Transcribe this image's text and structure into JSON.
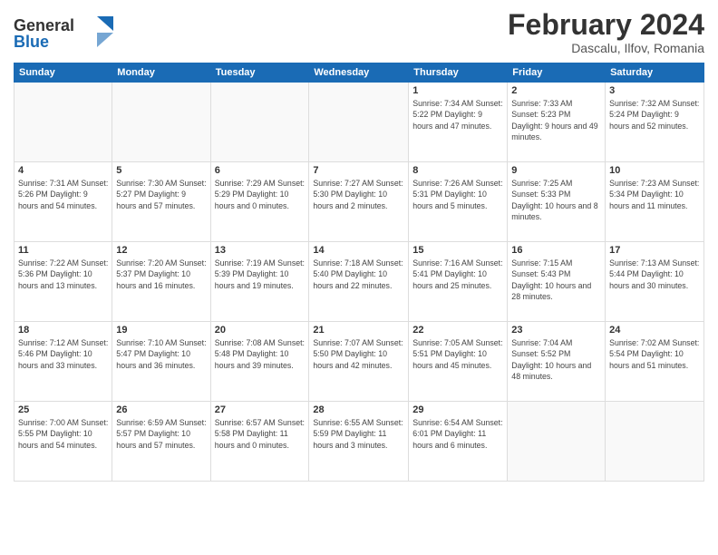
{
  "logo": {
    "line1": "General",
    "line2": "Blue"
  },
  "title": "February 2024",
  "location": "Dascalu, Ilfov, Romania",
  "days_of_week": [
    "Sunday",
    "Monday",
    "Tuesday",
    "Wednesday",
    "Thursday",
    "Friday",
    "Saturday"
  ],
  "weeks": [
    [
      {
        "day": "",
        "info": ""
      },
      {
        "day": "",
        "info": ""
      },
      {
        "day": "",
        "info": ""
      },
      {
        "day": "",
        "info": ""
      },
      {
        "day": "1",
        "info": "Sunrise: 7:34 AM\nSunset: 5:22 PM\nDaylight: 9 hours\nand 47 minutes."
      },
      {
        "day": "2",
        "info": "Sunrise: 7:33 AM\nSunset: 5:23 PM\nDaylight: 9 hours\nand 49 minutes."
      },
      {
        "day": "3",
        "info": "Sunrise: 7:32 AM\nSunset: 5:24 PM\nDaylight: 9 hours\nand 52 minutes."
      }
    ],
    [
      {
        "day": "4",
        "info": "Sunrise: 7:31 AM\nSunset: 5:26 PM\nDaylight: 9 hours\nand 54 minutes."
      },
      {
        "day": "5",
        "info": "Sunrise: 7:30 AM\nSunset: 5:27 PM\nDaylight: 9 hours\nand 57 minutes."
      },
      {
        "day": "6",
        "info": "Sunrise: 7:29 AM\nSunset: 5:29 PM\nDaylight: 10 hours\nand 0 minutes."
      },
      {
        "day": "7",
        "info": "Sunrise: 7:27 AM\nSunset: 5:30 PM\nDaylight: 10 hours\nand 2 minutes."
      },
      {
        "day": "8",
        "info": "Sunrise: 7:26 AM\nSunset: 5:31 PM\nDaylight: 10 hours\nand 5 minutes."
      },
      {
        "day": "9",
        "info": "Sunrise: 7:25 AM\nSunset: 5:33 PM\nDaylight: 10 hours\nand 8 minutes."
      },
      {
        "day": "10",
        "info": "Sunrise: 7:23 AM\nSunset: 5:34 PM\nDaylight: 10 hours\nand 11 minutes."
      }
    ],
    [
      {
        "day": "11",
        "info": "Sunrise: 7:22 AM\nSunset: 5:36 PM\nDaylight: 10 hours\nand 13 minutes."
      },
      {
        "day": "12",
        "info": "Sunrise: 7:20 AM\nSunset: 5:37 PM\nDaylight: 10 hours\nand 16 minutes."
      },
      {
        "day": "13",
        "info": "Sunrise: 7:19 AM\nSunset: 5:39 PM\nDaylight: 10 hours\nand 19 minutes."
      },
      {
        "day": "14",
        "info": "Sunrise: 7:18 AM\nSunset: 5:40 PM\nDaylight: 10 hours\nand 22 minutes."
      },
      {
        "day": "15",
        "info": "Sunrise: 7:16 AM\nSunset: 5:41 PM\nDaylight: 10 hours\nand 25 minutes."
      },
      {
        "day": "16",
        "info": "Sunrise: 7:15 AM\nSunset: 5:43 PM\nDaylight: 10 hours\nand 28 minutes."
      },
      {
        "day": "17",
        "info": "Sunrise: 7:13 AM\nSunset: 5:44 PM\nDaylight: 10 hours\nand 30 minutes."
      }
    ],
    [
      {
        "day": "18",
        "info": "Sunrise: 7:12 AM\nSunset: 5:46 PM\nDaylight: 10 hours\nand 33 minutes."
      },
      {
        "day": "19",
        "info": "Sunrise: 7:10 AM\nSunset: 5:47 PM\nDaylight: 10 hours\nand 36 minutes."
      },
      {
        "day": "20",
        "info": "Sunrise: 7:08 AM\nSunset: 5:48 PM\nDaylight: 10 hours\nand 39 minutes."
      },
      {
        "day": "21",
        "info": "Sunrise: 7:07 AM\nSunset: 5:50 PM\nDaylight: 10 hours\nand 42 minutes."
      },
      {
        "day": "22",
        "info": "Sunrise: 7:05 AM\nSunset: 5:51 PM\nDaylight: 10 hours\nand 45 minutes."
      },
      {
        "day": "23",
        "info": "Sunrise: 7:04 AM\nSunset: 5:52 PM\nDaylight: 10 hours\nand 48 minutes."
      },
      {
        "day": "24",
        "info": "Sunrise: 7:02 AM\nSunset: 5:54 PM\nDaylight: 10 hours\nand 51 minutes."
      }
    ],
    [
      {
        "day": "25",
        "info": "Sunrise: 7:00 AM\nSunset: 5:55 PM\nDaylight: 10 hours\nand 54 minutes."
      },
      {
        "day": "26",
        "info": "Sunrise: 6:59 AM\nSunset: 5:57 PM\nDaylight: 10 hours\nand 57 minutes."
      },
      {
        "day": "27",
        "info": "Sunrise: 6:57 AM\nSunset: 5:58 PM\nDaylight: 11 hours\nand 0 minutes."
      },
      {
        "day": "28",
        "info": "Sunrise: 6:55 AM\nSunset: 5:59 PM\nDaylight: 11 hours\nand 3 minutes."
      },
      {
        "day": "29",
        "info": "Sunrise: 6:54 AM\nSunset: 6:01 PM\nDaylight: 11 hours\nand 6 minutes."
      },
      {
        "day": "",
        "info": ""
      },
      {
        "day": "",
        "info": ""
      }
    ]
  ]
}
